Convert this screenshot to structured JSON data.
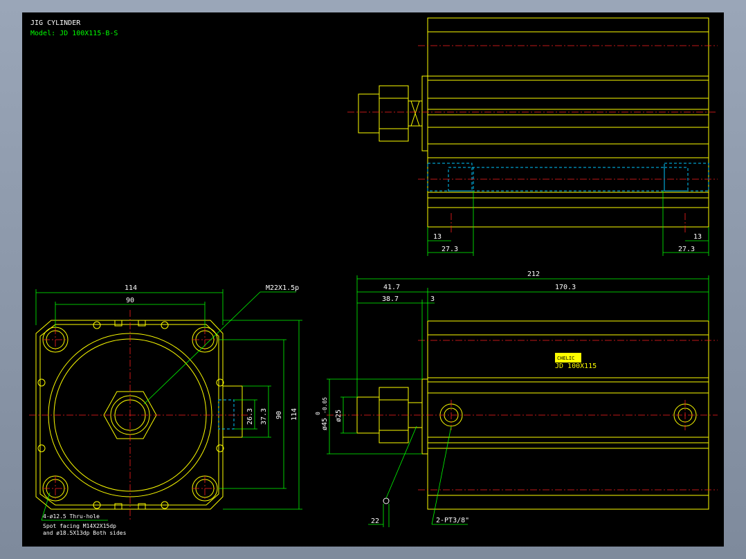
{
  "title_block": {
    "title": "JIG CYLINDER",
    "model": "Model: JD 100X115-B-S"
  },
  "top_view": {
    "dim_left_small": "13",
    "dim_left_large": "27.3",
    "dim_right_small": "13",
    "dim_right_large": "27.3"
  },
  "front_view": {
    "dim_width_outer": "114",
    "dim_width_pitch": "90",
    "dim_height_pitch": "90",
    "dim_height_outer": "114",
    "dim_port_small": "26.3",
    "dim_port_large": "37.3",
    "thread_callout": "M22X1.5p",
    "note_line1": "4-ø12.5 Thru-hole",
    "note_line2": "Spot facing  M14X2X15dp",
    "note_line3": "and ø18.5X13dp Both sides"
  },
  "side_view": {
    "dim_total": "212",
    "dim_rod_total": "41.7",
    "dim_body": "170.3",
    "dim_rod": "38.7",
    "dim_flange": "3",
    "dim_bore": "ø45",
    "dim_bore_tol": "-0.05",
    "dim_bore_tol_top": "0",
    "dim_rod_dia": "ø25",
    "dim_pin": "22",
    "port_note": "2-PT3/8\"",
    "brand_label": "CHELIC",
    "brand_sub": "JD 100X115"
  },
  "colors": {
    "background": "#000000",
    "outline": "#ffff00",
    "dimension": "#00ff00",
    "centerline": "#ff2020",
    "hidden": "#00c8ff",
    "text": "#ffffff"
  }
}
